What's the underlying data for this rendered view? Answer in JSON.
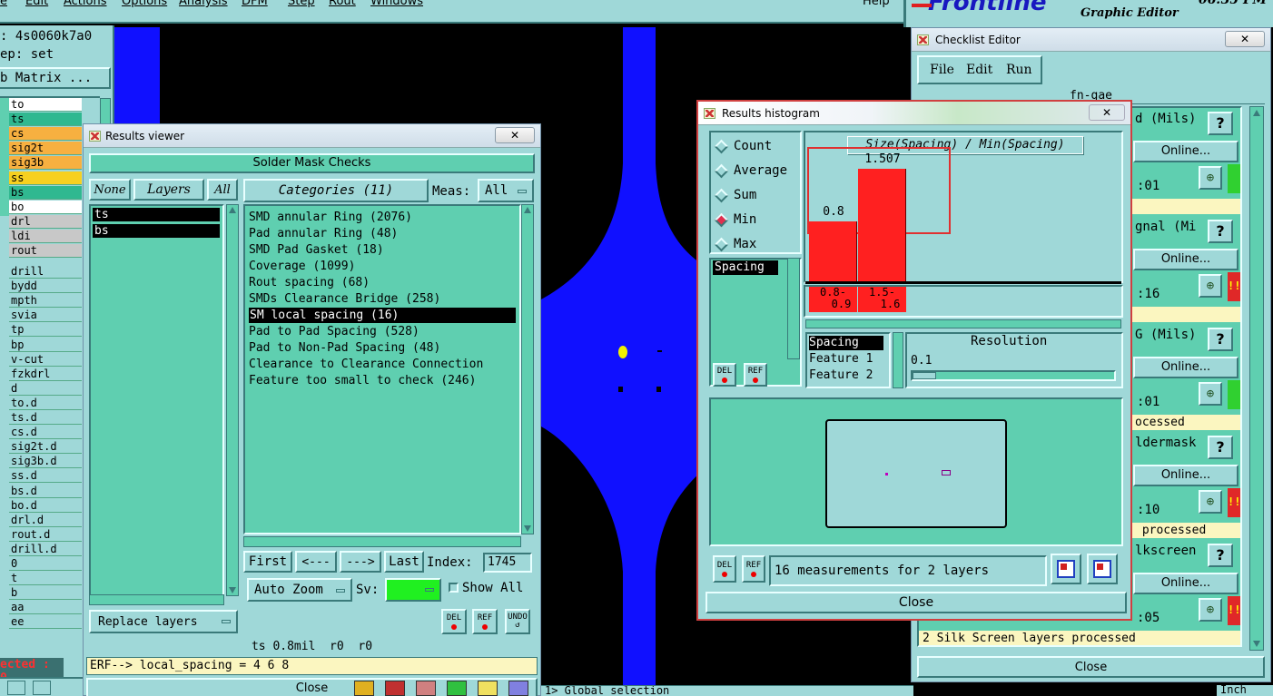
{
  "menubar": {
    "items": [
      "e",
      "Edit",
      "Actions",
      "Options",
      "Analysis",
      "DFM",
      "Step",
      "Rout",
      "Windows"
    ],
    "help": "Help",
    "logo": "Frontline",
    "app": "Graphic Editor",
    "clock": "06:35 PM"
  },
  "left": {
    "job": ": 4s0060k7a0",
    "step": "ep: set",
    "matrix": "b Matrix ...",
    "layers": [
      {
        "name": "to",
        "bg": "#ffffff"
      },
      {
        "name": "ts",
        "bg": "#30b890"
      },
      {
        "name": "cs",
        "bg": "#f7b040"
      },
      {
        "name": "sig2t",
        "bg": "#f7b040"
      },
      {
        "name": "sig3b",
        "bg": "#f7b040"
      },
      {
        "name": "ss",
        "bg": "#f7d020"
      },
      {
        "name": "bs",
        "bg": "#30b890"
      },
      {
        "name": "bo",
        "bg": "#ffffff"
      },
      {
        "name": "drl",
        "bg": "#c8c8c8"
      },
      {
        "name": "ldi",
        "bg": "#c8c8c8"
      },
      {
        "name": "rout",
        "bg": "#c8c8c8"
      },
      {
        "name": "drill",
        "bg": "#9fd8d8"
      },
      {
        "name": "bydd",
        "bg": "#9fd8d8"
      },
      {
        "name": "mpth",
        "bg": "#9fd8d8"
      },
      {
        "name": "svia",
        "bg": "#9fd8d8"
      },
      {
        "name": "tp",
        "bg": "#9fd8d8"
      },
      {
        "name": "bp",
        "bg": "#9fd8d8"
      },
      {
        "name": "v-cut",
        "bg": "#9fd8d8"
      },
      {
        "name": "fzkdrl",
        "bg": "#9fd8d8"
      },
      {
        "name": "d",
        "bg": "#9fd8d8"
      },
      {
        "name": "to.d",
        "bg": "#9fd8d8"
      },
      {
        "name": "ts.d",
        "bg": "#9fd8d8"
      },
      {
        "name": "cs.d",
        "bg": "#9fd8d8"
      },
      {
        "name": "sig2t.d",
        "bg": "#9fd8d8"
      },
      {
        "name": "sig3b.d",
        "bg": "#9fd8d8"
      },
      {
        "name": "ss.d",
        "bg": "#9fd8d8"
      },
      {
        "name": "bs.d",
        "bg": "#9fd8d8"
      },
      {
        "name": "bo.d",
        "bg": "#9fd8d8"
      },
      {
        "name": "drl.d",
        "bg": "#9fd8d8"
      },
      {
        "name": "rout.d",
        "bg": "#9fd8d8"
      },
      {
        "name": "drill.d",
        "bg": "#9fd8d8"
      },
      {
        "name": "0",
        "bg": "#9fd8d8"
      },
      {
        "name": "t",
        "bg": "#9fd8d8"
      },
      {
        "name": "b",
        "bg": "#9fd8d8"
      },
      {
        "name": "aa",
        "bg": "#9fd8d8"
      },
      {
        "name": "ee",
        "bg": "#9fd8d8"
      }
    ],
    "selected": "ected : 0"
  },
  "results_viewer": {
    "title": "Results viewer",
    "header": "Solder Mask Checks",
    "none_label": "None",
    "layers_label": "Layers",
    "all_label": "All",
    "categories_label": "Categories (11)",
    "meas_label": "Meas:",
    "meas_value": "All",
    "layer_items": [
      "ts",
      "bs"
    ],
    "categories": [
      "SMD annular Ring (2076)",
      "Pad annular Ring (48)",
      "SMD Pad Gasket (18)",
      "Coverage (1099)",
      "Rout spacing (68)",
      "SMDs Clearance Bridge (258)",
      "SM local spacing (16)",
      "Pad to Pad Spacing (528)",
      "Pad to Non-Pad Spacing (48)",
      "Clearance to Clearance Connection",
      "Feature too small to check (246)"
    ],
    "selected_index": 6,
    "first": "First",
    "prev": "<---",
    "next": "--->",
    "last": "Last",
    "index_label": "Index:",
    "index_value": "1745",
    "auto_zoom": "Auto Zoom",
    "sv_label": "Sv:",
    "show_all": "Show All",
    "replace_layers": "Replace layers",
    "del": "DEL",
    "ref": "REF",
    "undo": "UNDO",
    "info": "ts 0.8mil  r0  r0",
    "erf": "ERF--> local_spacing = 4 6 8",
    "close": "Close"
  },
  "histogram": {
    "title": "Results histogram",
    "modes": [
      "Count",
      "Average",
      "Sum",
      "Min",
      "Max"
    ],
    "selected_mode": "Min",
    "list_item": "Spacing",
    "chart_title": "Size(Spacing) / Min(Spacing)",
    "bars": [
      {
        "value": "0.8",
        "range_top": "0.8-",
        "range_bottom": "0.9"
      },
      {
        "value": "1.507",
        "range_top": "1.5-",
        "range_bottom": "1.6"
      }
    ],
    "fields": [
      "Spacing",
      "Feature 1",
      "Feature 2"
    ],
    "resolution_label": "Resolution",
    "resolution_value": "0.1",
    "del": "DEL",
    "ref": "REF",
    "status": "16 measurements for 2 layers",
    "close": "Close"
  },
  "checklist": {
    "title": "Checklist Editor",
    "menu": [
      "File",
      "Edit",
      "Run"
    ],
    "job": "fn-gae",
    "rows": [
      {
        "name": "d (Mils)",
        "online": "Online...",
        "time": ":01",
        "status": "",
        "flag": "#30d030"
      },
      {
        "name": "gnal (Mi",
        "online": "Online...",
        "time": ":16",
        "status": "",
        "flag": "#e02828"
      },
      {
        "name": "G (Mils)",
        "online": "Online...",
        "time": ":01",
        "status": "ocessed",
        "flag": "#30d030"
      },
      {
        "name": "ldermask",
        "online": "Online...",
        "time": ":10",
        "status": " processed",
        "flag": "#e02828"
      },
      {
        "name": "lkscreen",
        "online": "Online...",
        "time": ":05",
        "status": "2 Silk Screen layers processed",
        "flag": "#e02828"
      }
    ],
    "close": "Close"
  },
  "bottom": {
    "status": "1> Global selection",
    "units": "Inch"
  },
  "colors": {
    "panel": "#9fd8d8",
    "panel_dark": "#5fcfb0",
    "canvas_blue": "#1010ff",
    "highlight": "#ff2020"
  }
}
